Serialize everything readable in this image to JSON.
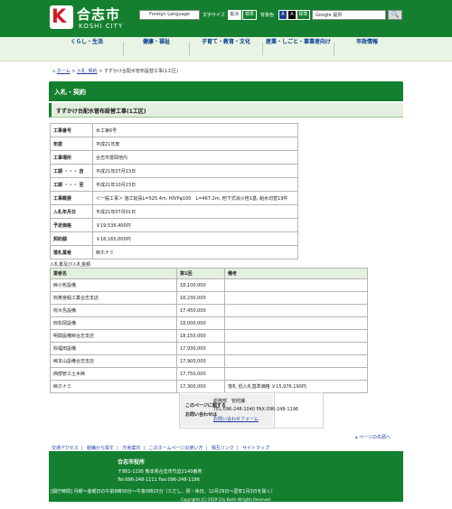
{
  "header": {
    "logo_mark": "K",
    "site_name": "合志市",
    "site_name_en": "KOSHI CITY",
    "language_select": "Foreign Language",
    "font_size_label": "文字サイズ",
    "font_size_large": "拡大",
    "font_size_normal": "標準",
    "bg_color_label": "背景色",
    "bg_blue": "A",
    "bg_black": "A",
    "bg_normal": "標準",
    "search_placeholder": "Google 提供",
    "search_icon": "search-icon",
    "colors": {
      "brand": "#14802f",
      "accent": "#d21c2a",
      "link": "#003a8c"
    }
  },
  "nav": {
    "items": [
      "くらし・生活",
      "健康・福祉",
      "子育て・教育・文化",
      "産業・しごと・事業者向け",
      "市政情報"
    ]
  },
  "breadcrumb": {
    "home_icon": "home-icon",
    "home": "ホーム",
    "sep": ">",
    "item1": "入札_契約",
    "item2": "すずかけ台配水管布設替工事(1工区)"
  },
  "page": {
    "title": "入札・契約",
    "subtitle": "すずかけ台配水管布設替工事(1工区)"
  },
  "info": [
    {
      "k": "工事番号",
      "v": "水工第6号"
    },
    {
      "k": "年度",
      "v": "平成21年度"
    },
    {
      "k": "工事場所",
      "v": "合志市豊岡地内"
    },
    {
      "k": "工期 ・・・ 自",
      "v": "平成21年07月13日"
    },
    {
      "k": "工期 ・・・ 至",
      "v": "平成21年10月23日"
    },
    {
      "k": "工事概要",
      "v": "＜一般工事＞ 施工延長L=525.4m, HIVPφ100　L=467.2m, 他下式消火栓1基, 給水切替19件"
    },
    {
      "k": "入札年月日",
      "v": "平成21年07月01日"
    },
    {
      "k": "予定価格",
      "v": "￥19,536,400円"
    },
    {
      "k": "契約額",
      "v": "￥18,165,000円"
    },
    {
      "k": "落札業者",
      "v": "㈱ホナミ"
    }
  ],
  "bids": {
    "label": "入札書及び入札金額",
    "headers": [
      "業者名",
      "第1回",
      "備考"
    ],
    "rows": [
      {
        "name": "㈱小牧設備",
        "amount": "18,100,000",
        "note": ""
      },
      {
        "name": "㈲奥宮組工業合志支店",
        "amount": "18,230,000",
        "note": ""
      },
      {
        "name": "㈲大島設備",
        "amount": "17,450,000",
        "note": ""
      },
      {
        "name": "㈲松岡設備",
        "amount": "18,000,000",
        "note": ""
      },
      {
        "name": "明興設備㈱合志支店",
        "amount": "18,150,000",
        "note": ""
      },
      {
        "name": "㈲福田設備",
        "amount": "17,930,000",
        "note": ""
      },
      {
        "name": "㈱本山設備合志支店",
        "amount": "17,900,000",
        "note": ""
      },
      {
        "name": "西部管工土木㈱",
        "amount": "17,750,000",
        "note": ""
      },
      {
        "name": "㈱ホナミ",
        "amount": "17,300,000",
        "note": "落札 低入札基準価格 ￥15,976,190円"
      }
    ]
  },
  "contact": {
    "title_line1": "このページに関する",
    "title_line2": "お問い合わせは",
    "dept": "総務部　管財課",
    "tel": "TEL:096-248-1040 FAX:096-248-1196",
    "form_link": "お問い合わせフォーム"
  },
  "pagetop": "ページの先頭へ",
  "footer_links": [
    "交通アクセス",
    "組織から探す",
    "庁舎案内",
    "このホームページの使い方",
    "相互リンク",
    "サイトマップ"
  ],
  "footer": {
    "name": "合志市役所",
    "address": "〒861-1195  熊本県合志市竹迫2140番地",
    "tel": "Tel:096-248-1111  Fax:096-248-1196",
    "hours": "[開庁時間] 月曜～金曜日の午前8時30分～午後5時15分（ただし、祝・休日、12月29日～翌年1月3日を除く）",
    "copyright": "Copyrights (C) 2019 City Koshi Allrights Reserved."
  }
}
